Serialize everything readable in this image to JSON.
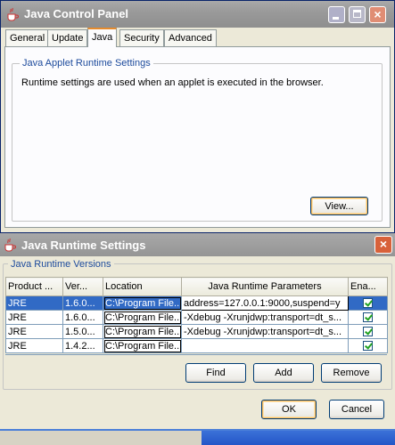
{
  "control_panel": {
    "title": "Java Control Panel",
    "tabs": [
      "General",
      "Update",
      "Java",
      "Security",
      "Advanced"
    ],
    "selected_tab": "Java",
    "group_title": "Java Applet Runtime Settings",
    "description": "Runtime settings are used when an applet is executed in the browser.",
    "view_button": "View..."
  },
  "runtime_dialog": {
    "title": "Java Runtime Settings",
    "close_glyph": "×",
    "group_title": "Java Runtime Versions",
    "columns": [
      "Product ...",
      "Ver...",
      "Location",
      "Java Runtime Parameters",
      "Ena..."
    ],
    "rows": [
      {
        "product": "JRE",
        "version": "1.6.0...",
        "location": "C:\\Program File...",
        "params": "address=127.0.0.1:9000,suspend=y",
        "enabled": true
      },
      {
        "product": "JRE",
        "version": "1.6.0...",
        "location": "C:\\Program File...",
        "params": "-Xdebug -Xrunjdwp:transport=dt_s...",
        "enabled": true
      },
      {
        "product": "JRE",
        "version": "1.5.0...",
        "location": "C:\\Program File...",
        "params": "-Xdebug -Xrunjdwp:transport=dt_s...",
        "enabled": true
      },
      {
        "product": "JRE",
        "version": "1.4.2...",
        "location": "C:\\Program File...",
        "params": "",
        "enabled": true
      }
    ],
    "buttons": {
      "find": "Find",
      "add": "Add",
      "remove": "Remove",
      "ok": "OK",
      "cancel": "Cancel"
    }
  },
  "colors": {
    "title_bar": "#9a9a9a",
    "selection": "#316ac5",
    "legend": "#1c4a9c",
    "close": "#d8613a"
  }
}
